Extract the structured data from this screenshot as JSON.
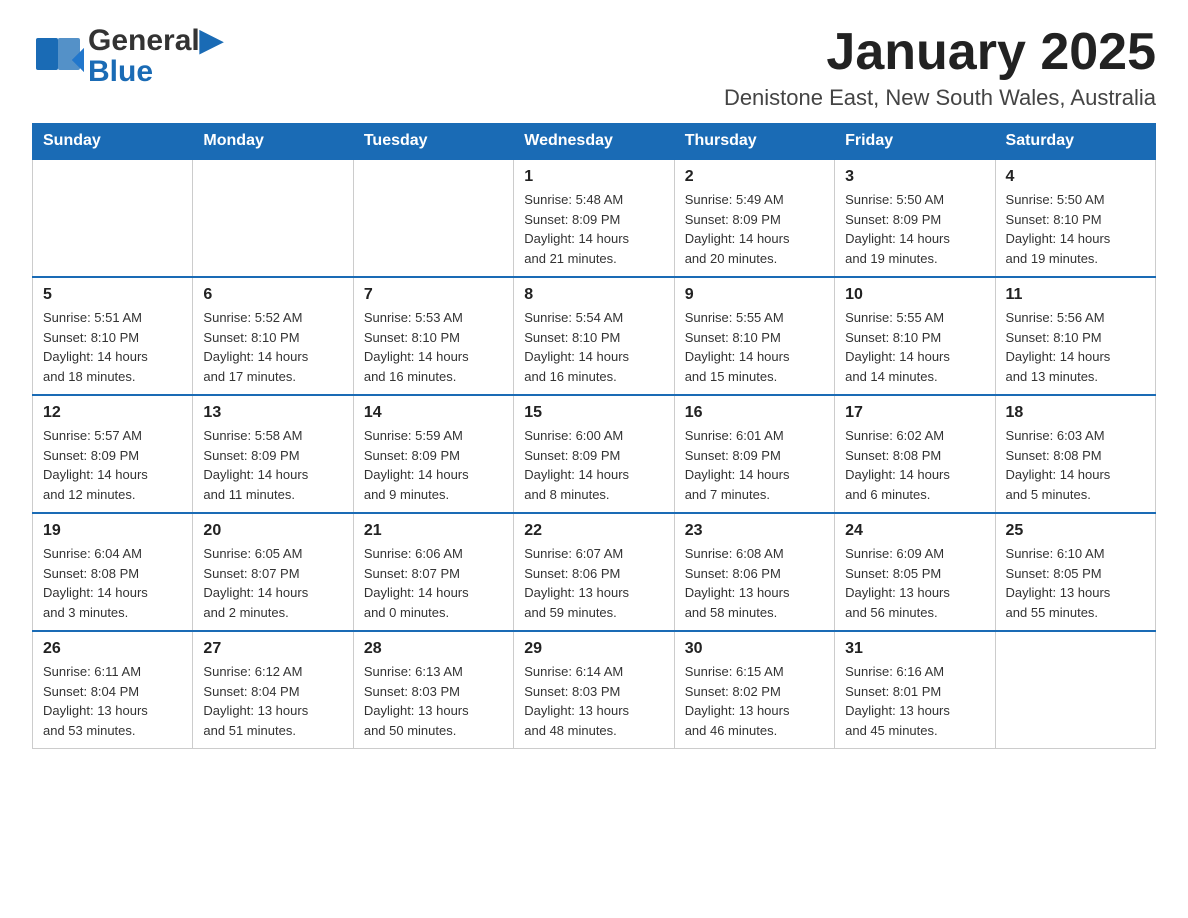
{
  "logo": {
    "general": "General",
    "blue": "Blue"
  },
  "title": "January 2025",
  "location": "Denistone East, New South Wales, Australia",
  "days_of_week": [
    "Sunday",
    "Monday",
    "Tuesday",
    "Wednesday",
    "Thursday",
    "Friday",
    "Saturday"
  ],
  "weeks": [
    [
      {
        "day": "",
        "info": ""
      },
      {
        "day": "",
        "info": ""
      },
      {
        "day": "",
        "info": ""
      },
      {
        "day": "1",
        "info": "Sunrise: 5:48 AM\nSunset: 8:09 PM\nDaylight: 14 hours\nand 21 minutes."
      },
      {
        "day": "2",
        "info": "Sunrise: 5:49 AM\nSunset: 8:09 PM\nDaylight: 14 hours\nand 20 minutes."
      },
      {
        "day": "3",
        "info": "Sunrise: 5:50 AM\nSunset: 8:09 PM\nDaylight: 14 hours\nand 19 minutes."
      },
      {
        "day": "4",
        "info": "Sunrise: 5:50 AM\nSunset: 8:10 PM\nDaylight: 14 hours\nand 19 minutes."
      }
    ],
    [
      {
        "day": "5",
        "info": "Sunrise: 5:51 AM\nSunset: 8:10 PM\nDaylight: 14 hours\nand 18 minutes."
      },
      {
        "day": "6",
        "info": "Sunrise: 5:52 AM\nSunset: 8:10 PM\nDaylight: 14 hours\nand 17 minutes."
      },
      {
        "day": "7",
        "info": "Sunrise: 5:53 AM\nSunset: 8:10 PM\nDaylight: 14 hours\nand 16 minutes."
      },
      {
        "day": "8",
        "info": "Sunrise: 5:54 AM\nSunset: 8:10 PM\nDaylight: 14 hours\nand 16 minutes."
      },
      {
        "day": "9",
        "info": "Sunrise: 5:55 AM\nSunset: 8:10 PM\nDaylight: 14 hours\nand 15 minutes."
      },
      {
        "day": "10",
        "info": "Sunrise: 5:55 AM\nSunset: 8:10 PM\nDaylight: 14 hours\nand 14 minutes."
      },
      {
        "day": "11",
        "info": "Sunrise: 5:56 AM\nSunset: 8:10 PM\nDaylight: 14 hours\nand 13 minutes."
      }
    ],
    [
      {
        "day": "12",
        "info": "Sunrise: 5:57 AM\nSunset: 8:09 PM\nDaylight: 14 hours\nand 12 minutes."
      },
      {
        "day": "13",
        "info": "Sunrise: 5:58 AM\nSunset: 8:09 PM\nDaylight: 14 hours\nand 11 minutes."
      },
      {
        "day": "14",
        "info": "Sunrise: 5:59 AM\nSunset: 8:09 PM\nDaylight: 14 hours\nand 9 minutes."
      },
      {
        "day": "15",
        "info": "Sunrise: 6:00 AM\nSunset: 8:09 PM\nDaylight: 14 hours\nand 8 minutes."
      },
      {
        "day": "16",
        "info": "Sunrise: 6:01 AM\nSunset: 8:09 PM\nDaylight: 14 hours\nand 7 minutes."
      },
      {
        "day": "17",
        "info": "Sunrise: 6:02 AM\nSunset: 8:08 PM\nDaylight: 14 hours\nand 6 minutes."
      },
      {
        "day": "18",
        "info": "Sunrise: 6:03 AM\nSunset: 8:08 PM\nDaylight: 14 hours\nand 5 minutes."
      }
    ],
    [
      {
        "day": "19",
        "info": "Sunrise: 6:04 AM\nSunset: 8:08 PM\nDaylight: 14 hours\nand 3 minutes."
      },
      {
        "day": "20",
        "info": "Sunrise: 6:05 AM\nSunset: 8:07 PM\nDaylight: 14 hours\nand 2 minutes."
      },
      {
        "day": "21",
        "info": "Sunrise: 6:06 AM\nSunset: 8:07 PM\nDaylight: 14 hours\nand 0 minutes."
      },
      {
        "day": "22",
        "info": "Sunrise: 6:07 AM\nSunset: 8:06 PM\nDaylight: 13 hours\nand 59 minutes."
      },
      {
        "day": "23",
        "info": "Sunrise: 6:08 AM\nSunset: 8:06 PM\nDaylight: 13 hours\nand 58 minutes."
      },
      {
        "day": "24",
        "info": "Sunrise: 6:09 AM\nSunset: 8:05 PM\nDaylight: 13 hours\nand 56 minutes."
      },
      {
        "day": "25",
        "info": "Sunrise: 6:10 AM\nSunset: 8:05 PM\nDaylight: 13 hours\nand 55 minutes."
      }
    ],
    [
      {
        "day": "26",
        "info": "Sunrise: 6:11 AM\nSunset: 8:04 PM\nDaylight: 13 hours\nand 53 minutes."
      },
      {
        "day": "27",
        "info": "Sunrise: 6:12 AM\nSunset: 8:04 PM\nDaylight: 13 hours\nand 51 minutes."
      },
      {
        "day": "28",
        "info": "Sunrise: 6:13 AM\nSunset: 8:03 PM\nDaylight: 13 hours\nand 50 minutes."
      },
      {
        "day": "29",
        "info": "Sunrise: 6:14 AM\nSunset: 8:03 PM\nDaylight: 13 hours\nand 48 minutes."
      },
      {
        "day": "30",
        "info": "Sunrise: 6:15 AM\nSunset: 8:02 PM\nDaylight: 13 hours\nand 46 minutes."
      },
      {
        "day": "31",
        "info": "Sunrise: 6:16 AM\nSunset: 8:01 PM\nDaylight: 13 hours\nand 45 minutes."
      },
      {
        "day": "",
        "info": ""
      }
    ]
  ]
}
